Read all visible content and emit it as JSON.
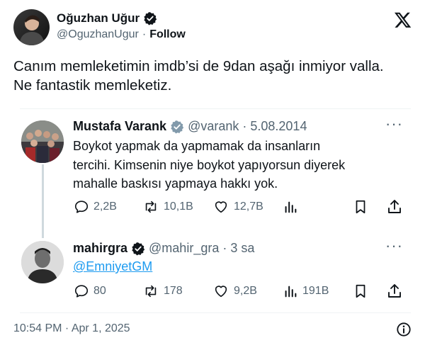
{
  "main_tweet": {
    "display_name": "Oğuzhan Uğur",
    "handle": "@OguzhanUgur",
    "separator": "·",
    "follow_label": "Follow",
    "text_line1": "Canım memleketimin imdb’si de 9dan aşağı inmiyor valla.",
    "text_line2": "Ne fantastik memleketiz.",
    "timestamp": "10:54 PM · Apr 1, 2025"
  },
  "quoted_thread": [
    {
      "display_name": "Mustafa Varank",
      "verified_badge": "gray",
      "handle": "@varank",
      "separator": "·",
      "date": "5.08.2014",
      "text_lines": [
        "Boykot yapmak da yapmamak da insanların",
        "tercihi. Kimsenin niye boykot yapıyorsun diyerek",
        "mahalle baskısı yapmaya hakkı yok."
      ],
      "metrics": {
        "replies": "2,2B",
        "reposts": "10,1B",
        "likes": "12,7B"
      }
    },
    {
      "display_name": "mahirgra",
      "verified_badge": "blue",
      "handle": "@mahir_gra",
      "separator": "·",
      "date": "3 sa",
      "text": "@EmniyetGM",
      "metrics": {
        "replies": "80",
        "reposts": "178",
        "likes": "9,2B",
        "views": "191B"
      }
    }
  ],
  "colors": {
    "text": "#0f1419",
    "secondary": "#536471",
    "link": "#1d9bf0",
    "verified_blue": "#1d9bf0",
    "verified_gray": "#829aab",
    "divider": "#eff3f4",
    "thread_line": "#cfd9de"
  }
}
